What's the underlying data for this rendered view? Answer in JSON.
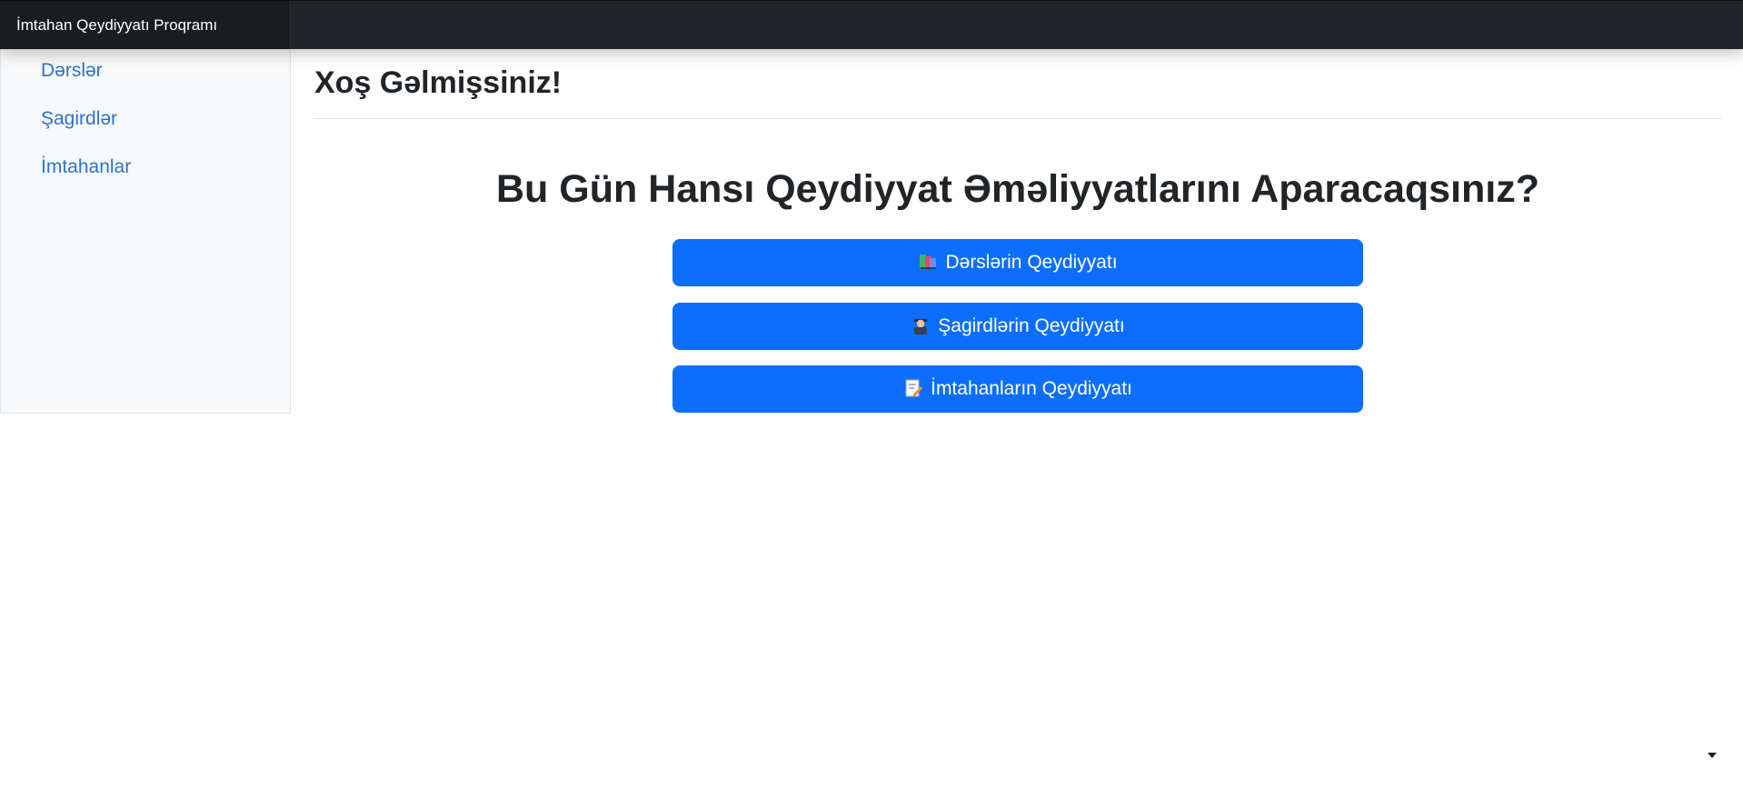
{
  "app": {
    "title": "İmtahan Qeydiyyatı Proqramı"
  },
  "sidebar": {
    "items": [
      {
        "label": "Dərslər"
      },
      {
        "label": "Şagirdlər"
      },
      {
        "label": "İmtahanlar"
      }
    ]
  },
  "main": {
    "title": "Xoş Gəlmişsiniz!",
    "question": "Bu Gün Hansı Qeydiyyat Əməliyyatlarını Aparacaqsınız?",
    "buttons": [
      {
        "label": "Dərslərin Qeydiyyatı",
        "icon": "books-icon"
      },
      {
        "label": "Şagirdlərin Qeydiyyatı",
        "icon": "student-icon"
      },
      {
        "label": "İmtahanların Qeydiyyatı",
        "icon": "memo-icon"
      }
    ]
  },
  "colors": {
    "navbar": "#212529",
    "sidebar_bg": "#f8f9fa",
    "link": "#2a73cf",
    "primary_button": "#0d6efd"
  }
}
